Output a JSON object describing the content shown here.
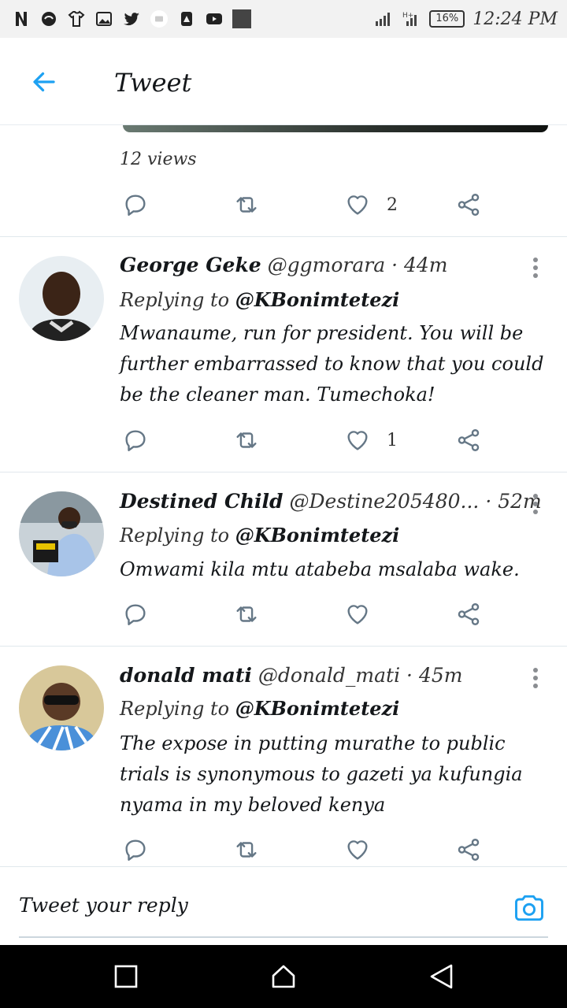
{
  "status_bar": {
    "battery": "16%",
    "time": "12:24 PM"
  },
  "header": {
    "title": "Tweet"
  },
  "tweet": {
    "views": "12 views",
    "likes": "2"
  },
  "replies": [
    {
      "name": "George Geke",
      "handle": "@ggmorara",
      "time": "· 44m",
      "replying_prefix": "Replying to ",
      "mention": "@KBonimtetezi",
      "text": "Mwanaume, run for president. You will be further embarrassed to know that you could be the cleaner man. Tumechoka!",
      "likes": "1"
    },
    {
      "name": "Destined Child",
      "handle": "@Destine205480...",
      "time": "· 52m",
      "replying_prefix": "Replying to ",
      "mention": "@KBonimtetezi",
      "text": "Omwami kila mtu atabeba msalaba wake.",
      "likes": ""
    },
    {
      "name": "donald mati",
      "handle": "@donald_mati",
      "time": "· 45m",
      "replying_prefix": "Replying to ",
      "mention": "@KBonimtetezi",
      "text": "The expose in putting murathe to public trials is synonymous to gazeti ya kufungia nyama in my beloved kenya",
      "likes": ""
    }
  ],
  "composer": {
    "placeholder": "Tweet your reply"
  },
  "colors": {
    "accent": "#1da1f2",
    "icon_gray": "#657786",
    "nav_bg": "#000000"
  }
}
